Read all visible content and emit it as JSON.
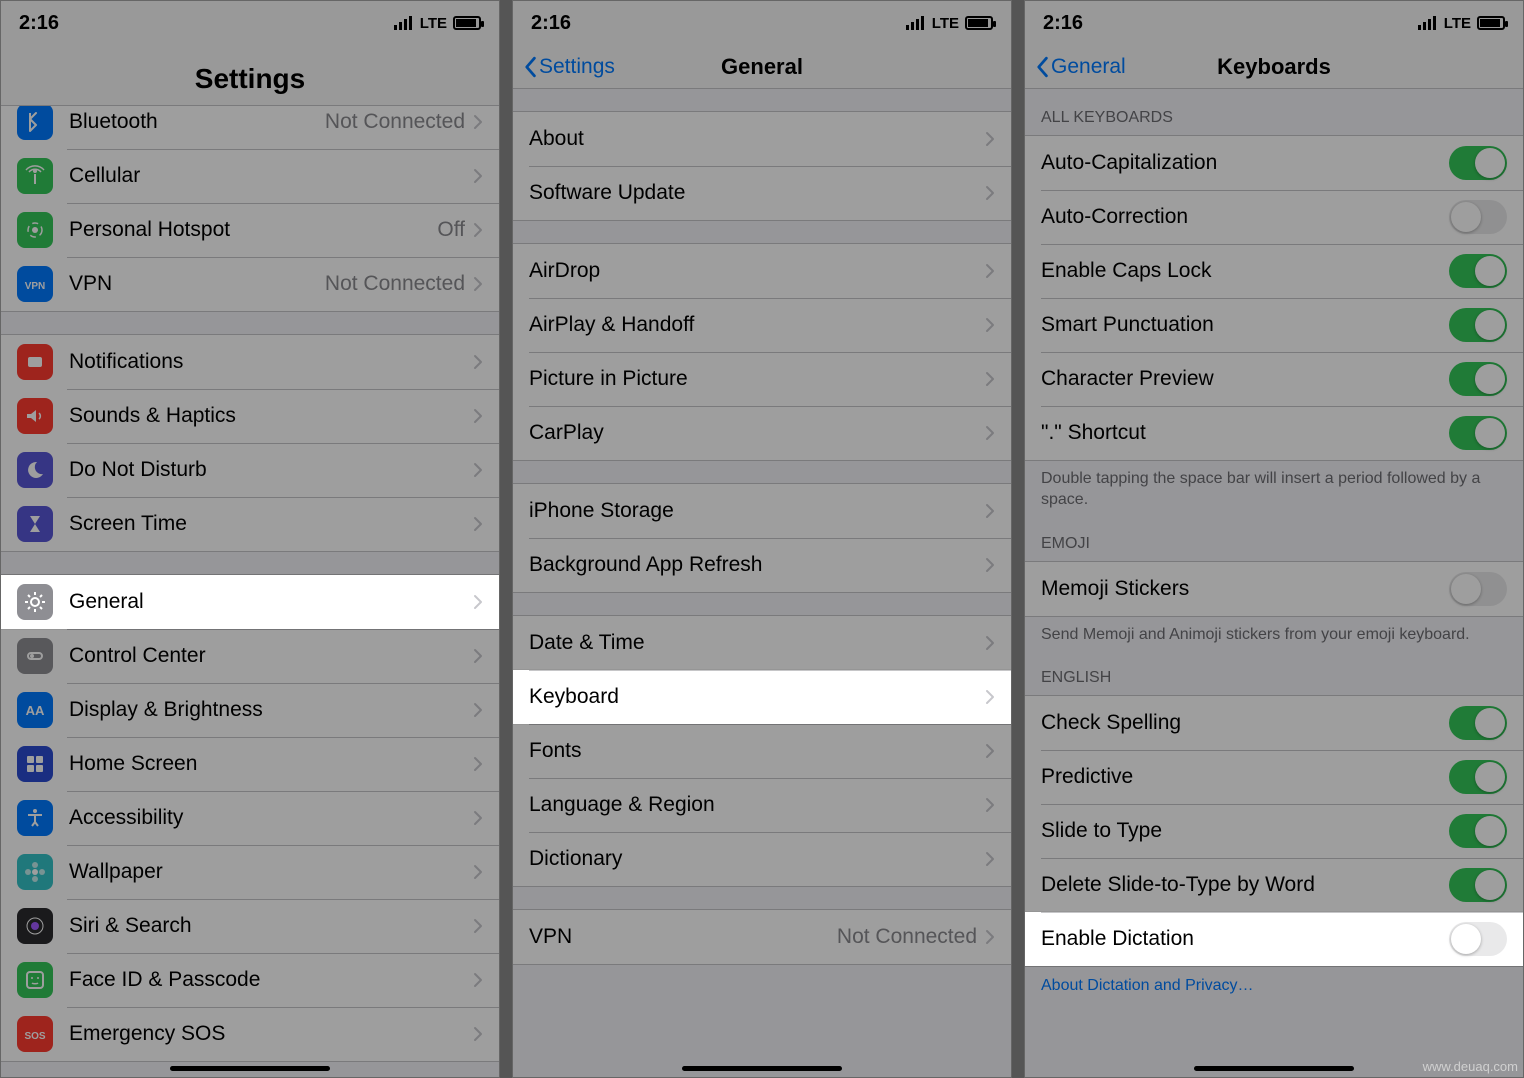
{
  "status": {
    "time": "2:16",
    "carrier": "LTE"
  },
  "screen1": {
    "title": "Settings",
    "groups": [
      {
        "rows": [
          {
            "icon": "bt",
            "label": "Bluetooth",
            "detail": "Not Connected",
            "color": "#007aff"
          },
          {
            "icon": "cell",
            "label": "Cellular",
            "detail": "",
            "color": "#34c759"
          },
          {
            "icon": "hotspot",
            "label": "Personal Hotspot",
            "detail": "Off",
            "color": "#34c759"
          },
          {
            "icon": "vpn",
            "label": "VPN",
            "detail": "Not Connected",
            "color": "#007aff"
          }
        ]
      },
      {
        "rows": [
          {
            "icon": "bell",
            "label": "Notifications",
            "color": "#ff3b30"
          },
          {
            "icon": "speaker",
            "label": "Sounds & Haptics",
            "color": "#ff3b30"
          },
          {
            "icon": "moon",
            "label": "Do Not Disturb",
            "color": "#5856d6"
          },
          {
            "icon": "hourglass",
            "label": "Screen Time",
            "color": "#5856d6"
          }
        ]
      },
      {
        "rows": [
          {
            "icon": "gear",
            "label": "General",
            "color": "#8e8e93",
            "highlight": true
          },
          {
            "icon": "cc",
            "label": "Control Center",
            "color": "#8e8e93"
          },
          {
            "icon": "aa",
            "label": "Display & Brightness",
            "color": "#007aff"
          },
          {
            "icon": "grid",
            "label": "Home Screen",
            "color": "#2b4bd0"
          },
          {
            "icon": "access",
            "label": "Accessibility",
            "color": "#007aff"
          },
          {
            "icon": "flower",
            "label": "Wallpaper",
            "color": "#34c2c7"
          },
          {
            "icon": "siri",
            "label": "Siri & Search",
            "color": "#2a2a2e"
          },
          {
            "icon": "faceid",
            "label": "Face ID & Passcode",
            "color": "#34c759"
          },
          {
            "icon": "sos",
            "label": "Emergency SOS",
            "color": "#ff3b30"
          }
        ]
      }
    ]
  },
  "screen2": {
    "back": "Settings",
    "title": "General",
    "groups": [
      [
        {
          "label": "About"
        },
        {
          "label": "Software Update"
        }
      ],
      [
        {
          "label": "AirDrop"
        },
        {
          "label": "AirPlay & Handoff"
        },
        {
          "label": "Picture in Picture"
        },
        {
          "label": "CarPlay"
        }
      ],
      [
        {
          "label": "iPhone Storage"
        },
        {
          "label": "Background App Refresh"
        }
      ],
      [
        {
          "label": "Date & Time"
        },
        {
          "label": "Keyboard",
          "highlight": true
        },
        {
          "label": "Fonts"
        },
        {
          "label": "Language & Region"
        },
        {
          "label": "Dictionary"
        }
      ],
      [
        {
          "label": "VPN",
          "detail": "Not Connected"
        }
      ]
    ]
  },
  "screen3": {
    "back": "General",
    "title": "Keyboards",
    "sections": [
      {
        "header": "ALL KEYBOARDS",
        "rows": [
          {
            "label": "Auto-Capitalization",
            "on": true
          },
          {
            "label": "Auto-Correction",
            "on": false
          },
          {
            "label": "Enable Caps Lock",
            "on": true
          },
          {
            "label": "Smart Punctuation",
            "on": true
          },
          {
            "label": "Character Preview",
            "on": true
          },
          {
            "label": "\".\" Shortcut",
            "on": true
          }
        ],
        "footer": "Double tapping the space bar will insert a period followed by a space."
      },
      {
        "header": "EMOJI",
        "rows": [
          {
            "label": "Memoji Stickers",
            "on": false
          }
        ],
        "footer": "Send Memoji and Animoji stickers from your emoji keyboard."
      },
      {
        "header": "ENGLISH",
        "rows": [
          {
            "label": "Check Spelling",
            "on": true
          },
          {
            "label": "Predictive",
            "on": true
          },
          {
            "label": "Slide to Type",
            "on": true
          },
          {
            "label": "Delete Slide-to-Type by Word",
            "on": true
          },
          {
            "label": "Enable Dictation",
            "on": false,
            "highlight": true
          }
        ],
        "link": "About Dictation and Privacy…"
      }
    ]
  },
  "watermark": "www.deuaq.com"
}
